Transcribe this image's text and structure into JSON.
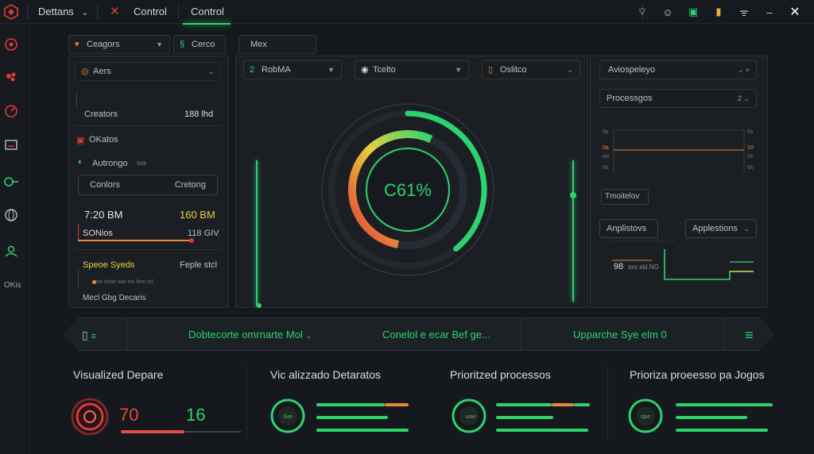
{
  "topbar": {
    "menu_label": "Dettans",
    "control1": "Control",
    "control2": "Control",
    "icons": [
      "wifi-icon",
      "emoji-icon",
      "lock-icon",
      "battery-icon",
      "signal-icon",
      "minimize-icon",
      "close-icon"
    ]
  },
  "sidebar": {
    "items": [
      "shield-icon",
      "gear-icon",
      "gauge-icon",
      "monitor-icon",
      "toggle-icon",
      "globe-icon",
      "user-icon"
    ],
    "bottom_label": "OKis"
  },
  "left_panel": {
    "tab1": "Ceagors",
    "tab2": "Cerco",
    "tab3": "Mex",
    "aers": "Aers",
    "creators_label": "Creators",
    "creators_value": "188 lhd",
    "okatos": "OKatos",
    "autorogo": "Autrongo",
    "autorogo_small": "sxs",
    "button_left": "Conlors",
    "button_right": "Cretong",
    "time_label": "7:20 BM",
    "time_value": "160 BM",
    "sonios": "SONios",
    "sonios_value": "118 GIV",
    "speed_label": "Speoe Syeds",
    "speed_value": "Feple stcl",
    "small_line": "exs  srlae  sax  eis  fom  srl",
    "footer": "Mecl  Gbg  Decaris",
    "accent_green": "#2dd36f",
    "accent_orange": "#e8863a"
  },
  "center_panel": {
    "dd1": "RobMA",
    "dd2": "Tcelto",
    "dd3": "Oslitco",
    "gauge_value": "C61%",
    "gauge_percent": 61
  },
  "right_panel": {
    "dd1": "Aviospeleyo",
    "dd2": "Processgos",
    "tag": "Tmoitelov",
    "btn1": "Anplistovs",
    "btn2": "Applestions",
    "readout": "98",
    "readout_small": "sxs  sld  NO",
    "axis_ticks_left": [
      "0s",
      "0a",
      "ws",
      "0s"
    ],
    "axis_ticks_right": [
      "0s",
      "10",
      "0s",
      "0s"
    ]
  },
  "command_bar": {
    "item1": "Dobtecorte omrnarte Mol",
    "item2": "Conelol e ecar Bef ge...",
    "item3": "Upparche Sye elm 0"
  },
  "stats": [
    {
      "title": "Visualized Depare",
      "v1": "70",
      "v2": "16"
    },
    {
      "title": "Vic alizzado Detaratos",
      "ring_label": "Gei"
    },
    {
      "title": "Prioritzed processos",
      "ring_label": "sow"
    },
    {
      "title": "Prioriza proeesso pa Jogos",
      "ring_label": "ope"
    }
  ]
}
